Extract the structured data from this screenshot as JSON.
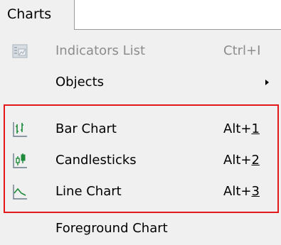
{
  "menubar": {
    "tab_label": "Charts"
  },
  "menu": {
    "items": [
      {
        "label": "Indicators List",
        "shortcut": "Ctrl+I",
        "disabled": true,
        "icon": "indicators-list-icon"
      },
      {
        "label": "Objects",
        "submenu": true
      },
      {
        "label": "Bar Chart",
        "shortcut_prefix": "Alt+",
        "shortcut_key": "1",
        "icon": "bar-chart-icon"
      },
      {
        "label": "Candlesticks",
        "shortcut_prefix": "Alt+",
        "shortcut_key": "2",
        "icon": "candlesticks-icon"
      },
      {
        "label": "Line Chart",
        "shortcut_prefix": "Alt+",
        "shortcut_key": "3",
        "icon": "line-chart-icon"
      },
      {
        "label": "Foreground Chart"
      }
    ]
  },
  "colors": {
    "menu_background": "#f0f0f0",
    "highlight_border": "#e3181b",
    "icon_green": "#1f8a3a",
    "icon_gray": "#6b7a8a",
    "disabled_text": "#8c8c8c"
  }
}
